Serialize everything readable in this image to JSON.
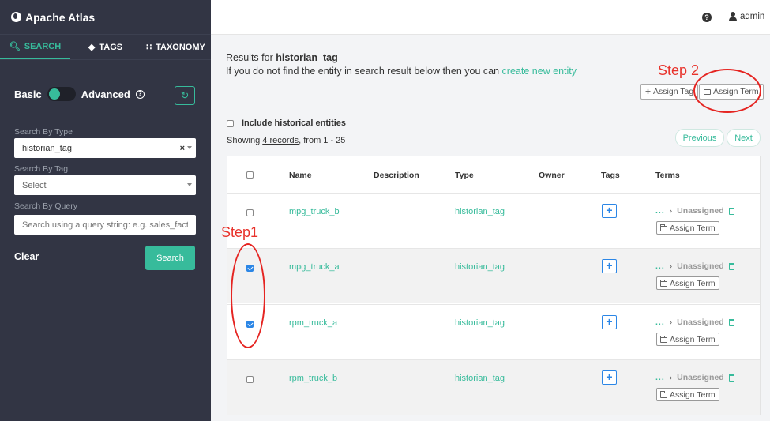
{
  "app": {
    "title": "Apache Atlas"
  },
  "sidebar": {
    "tabs": [
      {
        "label": "SEARCH",
        "icon": "search-icon"
      },
      {
        "label": "TAGS",
        "icon": "tag-icon"
      },
      {
        "label": "TAXONOMY",
        "icon": "sitemap-icon"
      }
    ],
    "mode": {
      "basic": "Basic",
      "advanced": "Advanced",
      "selected": "Basic"
    },
    "search_by_type": {
      "label": "Search By Type",
      "value": "historian_tag"
    },
    "search_by_tag": {
      "label": "Search By Tag",
      "value": "Select"
    },
    "search_by_query": {
      "label": "Search By Query",
      "placeholder": "Search using a query string: e.g. sales_fact"
    },
    "clear_label": "Clear",
    "search_label": "Search"
  },
  "header": {
    "user": "admin"
  },
  "main": {
    "results_prefix": "Results for",
    "results_term": "historian_tag",
    "not_found_text": "If you do not find the entity in search result below then you can",
    "create_link": "create new entity",
    "assign_tag_label": "Assign Tag",
    "assign_term_label": "Assign Term",
    "include_historical": "Include historical entities",
    "showing_prefix": "Showing",
    "showing_count": "4 records",
    "showing_suffix": ", from 1 - 25",
    "previous_label": "Previous",
    "next_label": "Next",
    "columns": [
      "Name",
      "Description",
      "Type",
      "Owner",
      "Tags",
      "Terms"
    ],
    "rows": [
      {
        "name": "mpg_truck_b",
        "type": "historian_tag",
        "checked": false,
        "term": "Unassigned",
        "dots": "...",
        "assign": "Assign Term"
      },
      {
        "name": "mpg_truck_a",
        "type": "historian_tag",
        "checked": true,
        "term": "Unassigned",
        "dots": "...",
        "assign": "Assign Term"
      },
      {
        "name": "rpm_truck_a",
        "type": "historian_tag",
        "checked": true,
        "term": "Unassigned",
        "dots": "...",
        "assign": "Assign Term"
      },
      {
        "name": "rpm_truck_b",
        "type": "historian_tag",
        "checked": false,
        "term": "Unassigned",
        "dots": "...",
        "assign": "Assign Term"
      }
    ]
  },
  "annotations": {
    "step1": "Step1",
    "step2": "Step 2",
    "color": "#e52421"
  },
  "colors": {
    "sidebar_bg": "#323544",
    "accent": "#37bb9b",
    "checkbox": "#2b86e6"
  }
}
